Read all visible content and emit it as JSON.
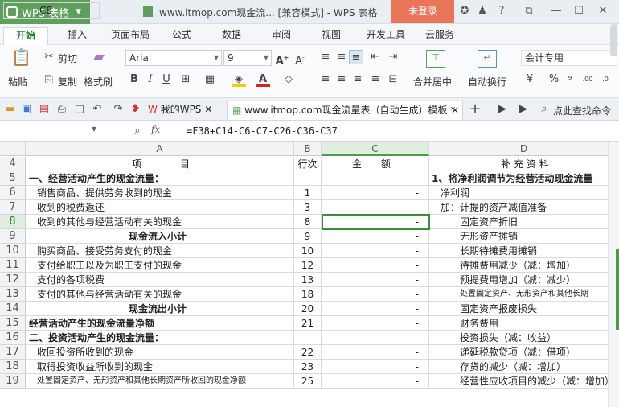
{
  "titlebar": {
    "app": "WPS 表格",
    "title": "www.itmop.com现金流... [兼容模式] - WPS 表格",
    "login": "未登录"
  },
  "tabs": [
    "开始",
    "插入",
    "页面布局",
    "公式",
    "数据",
    "审阅",
    "视图",
    "开发工具",
    "云服务"
  ],
  "ribbon": {
    "paste": "粘贴",
    "cut": "剪切",
    "copy": "复制",
    "format_painter": "格式刷",
    "font": "Arial",
    "size": "9",
    "merge": "合并居中",
    "wrap": "自动换行",
    "numfmt": "会计专用"
  },
  "doctabs": {
    "home": "我的WPS",
    "file": "www.itmop.com现金流量表（自动生成）模板 *",
    "search": "点此查找命令"
  },
  "formula": {
    "cell": "C8",
    "fx": "fx",
    "text": "=F38+C14-C6-C7-C26-C36-C37"
  },
  "columns": [
    "A",
    "B",
    "C",
    "D"
  ],
  "rows": [
    {
      "n": "4",
      "a": "项　　　　目",
      "b": "行次",
      "c": "金　　额",
      "d": "补 充 资 料"
    },
    {
      "n": "5",
      "a": "一、经营活动产生的现金流量：",
      "b": "",
      "c": "",
      "d": "1、将净利润调节为经营活动现金流量"
    },
    {
      "n": "6",
      "a": "销售商品、提供劳务收到的现金",
      "b": "1",
      "c": "-",
      "d": "净利润"
    },
    {
      "n": "7",
      "a": "收到的税费返还",
      "b": "3",
      "c": "-",
      "d": "加：计提的资产减值准备"
    },
    {
      "n": "8",
      "a": "收到的其他与经营活动有关的现金",
      "b": "8",
      "c": "-",
      "d": "固定资产折旧"
    },
    {
      "n": "9",
      "a": "现金流入小计",
      "b": "9",
      "c": "-",
      "d": "无形资产摊销"
    },
    {
      "n": "10",
      "a": "购买商品、接受劳务支付的现金",
      "b": "10",
      "c": "-",
      "d": "长期待摊费用摊销"
    },
    {
      "n": "11",
      "a": "支付给职工以及为职工支付的现金",
      "b": "12",
      "c": "-",
      "d": "待摊费用减少（减：增加）"
    },
    {
      "n": "12",
      "a": "支付的各项税费",
      "b": "13",
      "c": "-",
      "d": "预提费用增加（减：减少）"
    },
    {
      "n": "13",
      "a": "支付的其他与经营活动有关的现金",
      "b": "18",
      "c": "-",
      "d": "处置固定资产、无形资产和其他长期"
    },
    {
      "n": "14",
      "a": "现金流出小计",
      "b": "20",
      "c": "-",
      "d": "固定资产报废损失"
    },
    {
      "n": "15",
      "a": "经营活动产生的现金流量净额",
      "b": "21",
      "c": "-",
      "d": "财务费用"
    },
    {
      "n": "16",
      "a": "二、投资活动产生的现金流量：",
      "b": "",
      "c": "",
      "d": "投资损失（减：收益）"
    },
    {
      "n": "17",
      "a": "收回投资所收到的现金",
      "b": "22",
      "c": "-",
      "d": "递延税款贷项（减：借项）"
    },
    {
      "n": "18",
      "a": "取得投资收益所收到的现金",
      "b": "23",
      "c": "-",
      "d": "存货的减少（减：增加）"
    },
    {
      "n": "19",
      "a": "处置固定资产、无形资产和其他长期资产所收回的现金净额",
      "b": "25",
      "c": "-",
      "d": "经营性应收项目的减少（减：增加）"
    }
  ]
}
